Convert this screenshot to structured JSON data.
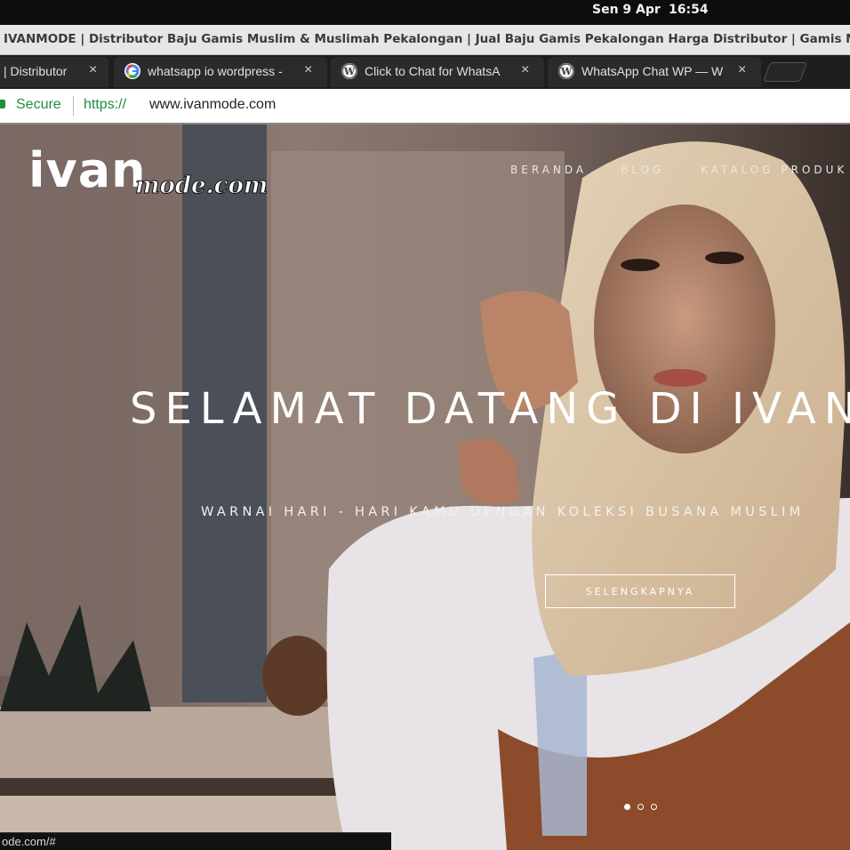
{
  "os_bar": {
    "date": "Sen 9 Apr",
    "time": "16:54"
  },
  "window": {
    "title": "IVANMODE | Distributor Baju Gamis Muslim & Muslimah Pekalongan | Jual Baju Gamis Pekalongan Harga Distributor | Gamis Mu"
  },
  "tabs": [
    {
      "label": "| Distributor",
      "icon": "site-favicon",
      "close": "×"
    },
    {
      "label": "whatsapp io wordpress -",
      "icon": "google-icon",
      "close": "×"
    },
    {
      "label": "Click to Chat for WhatsA",
      "icon": "wordpress-icon",
      "close": "×"
    },
    {
      "label": "WhatsApp Chat WP — W",
      "icon": "wordpress-icon",
      "close": "×"
    }
  ],
  "address_bar": {
    "security_label": "Secure",
    "url_scheme": "https://",
    "url_host": "www.ivanmode.com",
    "secure_color": "#1e8e3e"
  },
  "site": {
    "logo_main": "ivan",
    "logo_sub": "mode.com",
    "nav": {
      "home": "BERANDA",
      "blog": "BLOG",
      "catalog": "KATALOG PRODUK ▾"
    },
    "hero": {
      "title": "SELAMAT DATANG DI IVANMODE",
      "subtitle": "WARNAI HARI - HARI KAMU DENGAN KOLEKSI BUSANA MUSLIM",
      "button": "SELENGKAPNYA",
      "slide_count": 3,
      "active_slide": 1
    }
  },
  "status_bar": {
    "url": "ode.com/#"
  }
}
